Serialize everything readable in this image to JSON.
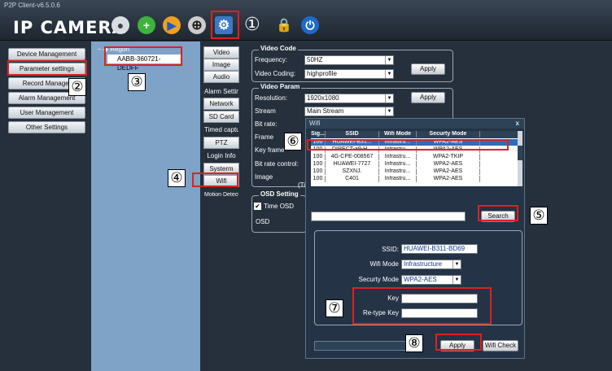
{
  "app": {
    "version": "P2P Client-v6.5.0.6",
    "brand": "IP CAMERA",
    "toolbar_num": "①"
  },
  "left_menu": [
    "Device Management",
    "Parameter settings",
    "Record Manager",
    "Alarm Management",
    "User Management",
    "Other Settings"
  ],
  "tree": {
    "root": "Regon",
    "device": "AABB-360721-DEDFF"
  },
  "tabs": [
    "Video",
    "Image",
    "Audio",
    "Alarm Setting",
    "Network",
    "SD Card",
    "Timed capture",
    "PTZ",
    "Login Info",
    "Systerm",
    "Wifi",
    "Motion Detection"
  ],
  "video_code": {
    "title": "Video Code",
    "frequency_label": "Frequency:",
    "frequency_value": "50HZ",
    "coding_label": "Video Coding:",
    "coding_value": "highprofile",
    "apply": "Apply"
  },
  "video_param": {
    "title": "Video Param",
    "resolution_label": "Resolution:",
    "resolution_value": "1920x1080",
    "stream_label": "Stream",
    "stream_value": "Main Stream",
    "bitrate_label": "Bit rate:",
    "frame_label": "Frame",
    "keyframe_label": "Key frame",
    "bitrate_control_label": "Bit rate control:",
    "image_label": "Image",
    "image_sub": "(Ti",
    "apply": "Apply"
  },
  "osd": {
    "title": "OSD Setting",
    "time_osd": "Time OSD",
    "osd_label": "OSD"
  },
  "wifi": {
    "title": "Wifi",
    "close": "x",
    "columns": [
      "Sig...",
      "SSID",
      "Wifi Mode",
      "Securty Mode"
    ],
    "rows": [
      [
        "100",
        "HUAWEI-B31...",
        "Infrastru...",
        "WPA2-AES"
      ],
      [
        "100",
        "DIRECT-a9-H...",
        "Infrastru...",
        "WPA2-AES"
      ],
      [
        "100",
        "4G-CPE-008567",
        "Infrastru...",
        "WPA2-TKIP"
      ],
      [
        "100",
        "HUAWEI-7727",
        "Infrastru...",
        "WPA2-AES"
      ],
      [
        "100",
        "SZXNJ.",
        "Infrastru...",
        "WPA2-AES"
      ],
      [
        "100",
        "C401",
        "Infrastru...",
        "WPA2-AES"
      ]
    ],
    "search": "Search",
    "ssid_label": "SSID:",
    "ssid_value": "HUAWEI-B311-BD69",
    "mode_label": "Wifi Mode",
    "mode_value": "Infrastructure",
    "security_label": "Securty Mode",
    "security_value": "WPA2-AES",
    "key_label": "Key",
    "retype_label": "Re-type Key",
    "apply": "Apply",
    "check": "Wifi Check"
  },
  "callouts": [
    "②",
    "③",
    "④",
    "⑤",
    "⑥",
    "⑦",
    "⑧"
  ],
  "colors": {
    "highlight": "#e02020",
    "tree_bg": "#7fa2c7",
    "selected_row": "#2f6db5"
  }
}
